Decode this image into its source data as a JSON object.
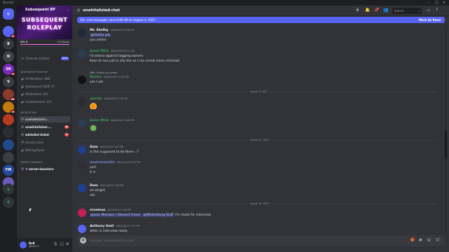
{
  "app": {
    "title": "Discord"
  },
  "rail": {
    "home_label": "",
    "servers": [
      {
        "label": "",
        "color": "#5865f2",
        "badge": "1"
      },
      {
        "label": "B",
        "color": "#36393f",
        "badge": ""
      },
      {
        "label": "N",
        "color": "#404249",
        "badge": ""
      },
      {
        "label": "SR",
        "color": "#7b2bbd",
        "badge": "2"
      },
      {
        "label": "V",
        "color": "#3a3d44",
        "badge": ""
      },
      {
        "label": "",
        "color": "#8a3b2a",
        "badge": "13"
      },
      {
        "label": "",
        "color": "#c27c0e",
        "badge": "6"
      },
      {
        "label": "",
        "color": "#b8391f",
        "badge": ""
      },
      {
        "label": "",
        "color": "#2c2e33",
        "badge": ""
      },
      {
        "label": "",
        "color": "#1f4a8a",
        "badge": ""
      },
      {
        "label": "",
        "color": "#3b3e45",
        "badge": ""
      },
      {
        "label": "FM",
        "color": "#244b9c",
        "badge": ""
      },
      {
        "label": "",
        "color": "#6b5bbd",
        "badge": ""
      }
    ],
    "add_icon": "+",
    "explore_icon": "compass-icon"
  },
  "server": {
    "name": "Subsequent RP",
    "logo_line1": "SUBSEQUENT",
    "logo_line2": "ROLEPLAY",
    "level": "LVL 3",
    "boosts": "15 Boosts",
    "boost_progress": 1.0,
    "channels_roles": "Channels & Roles",
    "new_pill": "NEW",
    "stats_category": "SUBSEQUENT ROLEPLAY",
    "stats": [
      "All Members: 668",
      "Subsequent Staff: 17",
      "Whitelisted: 297",
      "Unwhitelisted: 437"
    ],
    "whitelisting_category": "WHITELISTING",
    "whitelisting": [
      {
        "name": "unwhitelisted-c...",
        "badge": "",
        "active": true
      },
      {
        "name": "unwhitelisted-...",
        "badge": "88",
        "active": false
      },
      {
        "name": "whitelist-ticket",
        "badge": "12",
        "active": false
      },
      {
        "name": "servers-rules",
        "badge": "",
        "active": false
      },
      {
        "name": "Waiting Room",
        "badge": "",
        "active": false
      }
    ],
    "server_category": "SERVER CHANNELS",
    "server_channels": [
      "server-boosters"
    ]
  },
  "user": {
    "name": "BoK",
    "tag": "bok#173"
  },
  "header": {
    "channel": "unwhitelisted-chat",
    "search_placeholder": "Search"
  },
  "newbar": {
    "text": "50+ new messages since 8:46 AM on August 4, 2023",
    "mark": "Mark As Read"
  },
  "messages": [
    {
      "author": "Mr. Shelby",
      "time": "08/04/2023 8:46 AM",
      "lines": [
        "@Hostro yes",
        "you online"
      ],
      "color": "#f2f3f5",
      "avatar": "#1e2a3a"
    },
    {
      "author": "Jason Mick",
      "time": "08/04/2023 9:11 AM",
      "lines": [
        "I'd advise against tagging owners",
        "Keen to see yall in city tho  so I can arrest more criminals"
      ],
      "color": "#3ba55c",
      "avatar": "#2b3d4f"
    },
    {
      "reply": "@Mr. Shelby you online",
      "author": "Hostro",
      "time": "08/04/2023 11:34 AM",
      "lines": [
        "yes I am"
      ],
      "color": "#3ba55c",
      "avatar": "#111214"
    },
    {
      "author": "xpocks",
      "time": "08/04/2023 1:49 PM",
      "lines": [
        ""
      ],
      "color": "#3ba55c",
      "avatar": "#2a2c31"
    },
    {
      "author": "Jason Mick",
      "time": "08/04/2023 2:06 PM",
      "lines": [
        ""
      ],
      "color": "#3ba55c",
      "avatar": "#2b3d4f"
    },
    {
      "author": "Dom",
      "time": "08/15/2023 9:37 PM",
      "lines": [
        "is this supposed to be there...?"
      ],
      "color": "#f2f3f5",
      "avatar": "#1e3f8f"
    },
    {
      "author": "modrnaeentle",
      "time": "08/15/2023 9:32 PM",
      "lines": [
        "yes!",
        "it is"
      ],
      "color": "#7289da",
      "avatar": "#2d2f35"
    },
    {
      "author": "Dom",
      "time": "08/15/2023 9:38 PM",
      "lines": [
        "oh alright",
        "mb"
      ],
      "color": "#f2f3f5",
      "avatar": "#1e3f8f"
    },
    {
      "author": "eruemus",
      "time": "08/16/2023 4:06 PM",
      "lines": [
        "@Ivan Morozov | Stewart Fraser @Whitelisting Staff  I'm ready for interview"
      ],
      "color": "#f2f3f5",
      "avatar": "#c21f5a"
    },
    {
      "author": "Anthony Smit",
      "time": "08/16/2023 7:11 PM",
      "lines": [
        "when is interview ready"
      ],
      "color": "#f2f3f5",
      "avatar": "#5865f2"
    }
  ],
  "dates": [
    "August 8, 2023",
    "August 15, 2023",
    "August 16, 2023"
  ],
  "composer": {
    "placeholder": "Message #unwhitelisted-chat"
  }
}
